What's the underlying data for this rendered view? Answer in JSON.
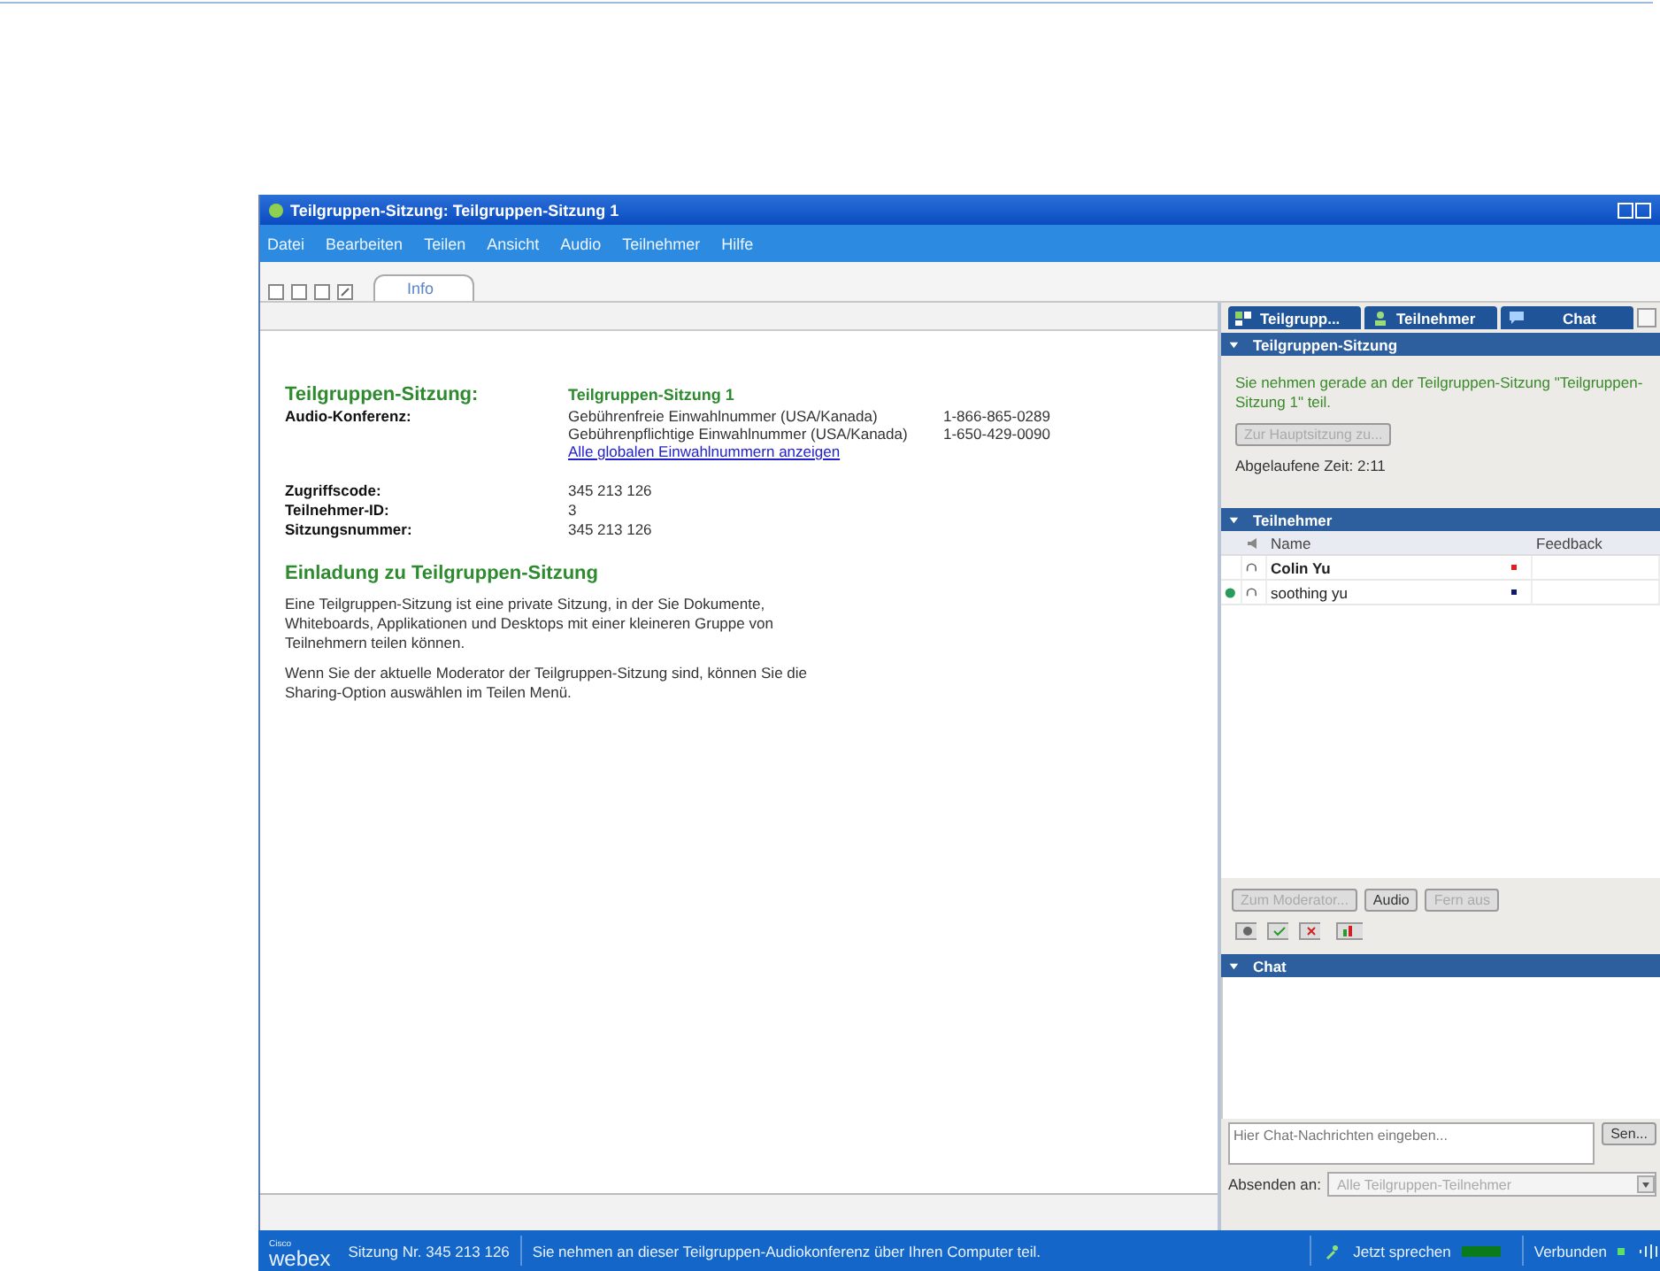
{
  "window": {
    "title": "Teilgruppen-Sitzung: Teilgruppen-Sitzung 1"
  },
  "menu": [
    "Datei",
    "Bearbeiten",
    "Teilen",
    "Ansicht",
    "Audio",
    "Teilnehmer",
    "Hilfe"
  ],
  "doc_tabs": [
    {
      "label": "Info",
      "selected": true
    }
  ],
  "info": {
    "title_label": "Teilgruppen-Sitzung:",
    "title_value": "Teilgruppen-Sitzung 1",
    "audio_label": "Audio-Konferenz:",
    "dial_in": [
      {
        "label": "Gebührenfreie Einwahlnummer (USA/Kanada)",
        "number": "1-866-865-0289"
      },
      {
        "label": "Gebührenpflichtige Einwahlnummer (USA/Kanada)",
        "number": "1-650-429-0090"
      }
    ],
    "link": "Alle globalen Einwahlnummern anzeigen",
    "details": [
      {
        "label": "Zugriffscode:",
        "value": "345 213 126"
      },
      {
        "label": "Teilnehmer-ID:",
        "value": "3"
      },
      {
        "label": "Sitzungsnummer:",
        "value": "345 213 126"
      }
    ],
    "heading": "Einladung zu Teilgruppen-Sitzung",
    "paragraphs": [
      "Eine Teilgruppen-Sitzung ist eine private Sitzung, in der Sie Dokumente, Whiteboards, Applikationen und Desktops mit einer kleineren Gruppe von Teilnehmern teilen können.",
      "Wenn Sie der aktuelle Moderator der Teilgruppen-Sitzung sind, können Sie die Sharing-Option auswählen im  Teilen  Menü."
    ]
  },
  "panel_tabs": [
    {
      "label": "Teilgrupp...",
      "kind": "groups",
      "selected": false
    },
    {
      "label": "Teilnehmer",
      "kind": "people",
      "selected": false
    },
    {
      "label": "Chat",
      "kind": "chat",
      "selected": false
    }
  ],
  "breakout": {
    "title": "Teilgruppen-Sitzung",
    "message": "Sie nehmen gerade an der Teilgruppen-Sitzung \"Teilgruppen-Sitzung 1\" teil.",
    "button": "Zur Hauptsitzung zu...",
    "elapsed": "Abgelaufene Zeit: 2:11"
  },
  "participants": {
    "title": "Teilnehmer",
    "columns": [
      "Name",
      "Feedback"
    ],
    "rows": [
      {
        "name": "Colin Yu",
        "bold": true,
        "presenter": false,
        "color": "#e02020"
      },
      {
        "name": "soothing yu",
        "bold": false,
        "presenter": true,
        "color": "#101870"
      }
    ],
    "buttons": [
      {
        "label": "Zum Moderator...",
        "disabled": true
      },
      {
        "label": "Audio",
        "disabled": false
      },
      {
        "label": "Fern aus",
        "disabled": true
      }
    ]
  },
  "chat": {
    "title": "Chat",
    "placeholder": "Hier Chat-Nachrichten eingeben...",
    "send": "Sen...",
    "to_label": "Absenden an:",
    "to_value": "Alle Teilgruppen-Teilnehmer"
  },
  "status_bar": {
    "logo_small": "Cisco",
    "logo": "webex",
    "session": "Sitzung Nr. 345 213 126",
    "message": "Sie nehmen an dieser Teilgruppen-Audiokonferenz über Ihren Computer teil.",
    "speak": "Jetzt sprechen",
    "connection": "Verbunden"
  }
}
